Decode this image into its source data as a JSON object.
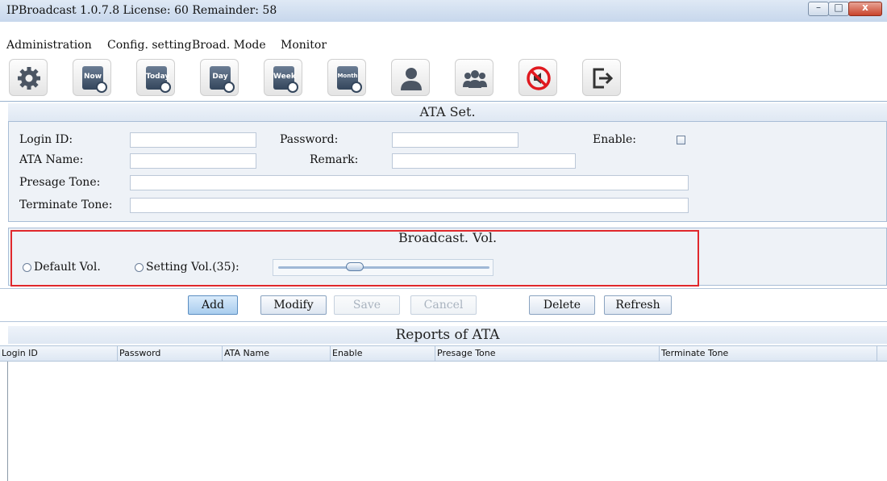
{
  "window": {
    "title": "IPBroadcast 1.0.7.8 License: 60 Remainder: 58"
  },
  "menu": [
    "Administration",
    "Config. setting",
    "Broad. Mode",
    "Monitor"
  ],
  "toolbar": {
    "calendar_labels": [
      "Now",
      "Today",
      "Day",
      "Week",
      "Month"
    ],
    "icons": [
      "gear-icon",
      "now-schedule-icon",
      "today-schedule-icon",
      "day-schedule-icon",
      "week-schedule-icon",
      "month-schedule-icon",
      "user-icon",
      "group-icon",
      "mute-icon",
      "exit-icon"
    ]
  },
  "ata_set": {
    "title": "ATA Set.",
    "login_id_label": "Login ID:",
    "password_label": "Password:",
    "enable_label": "Enable:",
    "ata_name_label": "ATA Name:",
    "remark_label": "Remark:",
    "presage_tone_label": "Presage Tone:",
    "terminate_tone_label": "Terminate Tone:",
    "enable_checked": false
  },
  "broadcast_vol": {
    "title": "Broadcast. Vol.",
    "default_label": "Default Vol.",
    "setting_label": "Setting Vol.(35):",
    "slider_value": 35,
    "slider_max": 100
  },
  "buttons": {
    "add": "Add",
    "modify": "Modify",
    "save": "Save",
    "cancel": "Cancel",
    "delete": "Delete",
    "refresh": "Refresh"
  },
  "reports": {
    "title": "Reports of ATA",
    "columns": [
      "Login ID",
      "Password",
      "ATA Name",
      "Enable",
      "Presage Tone",
      "Terminate Tone"
    ],
    "rows": []
  },
  "colors": {
    "highlight_border": "#e0282c",
    "accent": "#a9cdee"
  }
}
